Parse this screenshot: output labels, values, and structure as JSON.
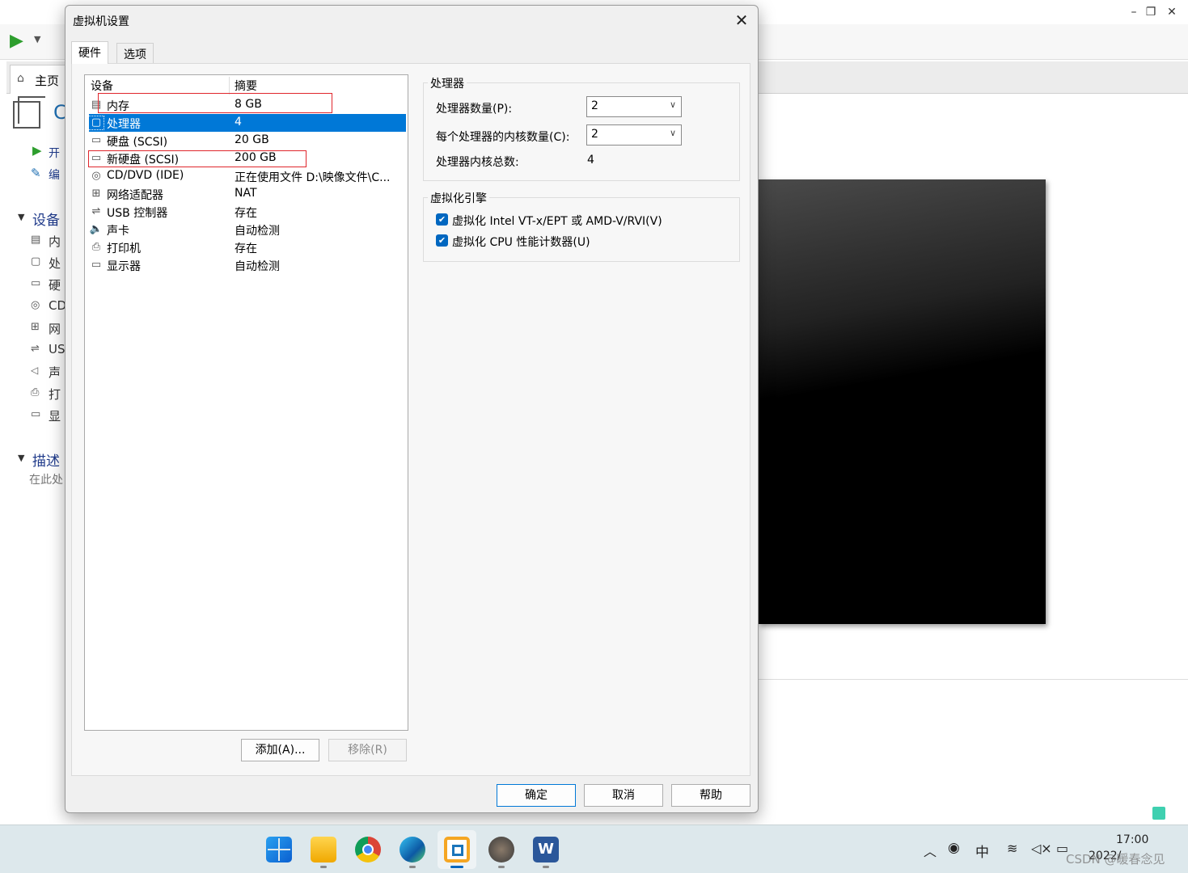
{
  "background_app": {
    "home_tab": "主页",
    "sidebar_actions": [
      "开",
      "编"
    ],
    "devices_section": "设备",
    "sidebar_devices": [
      "内",
      "处",
      "硬",
      "CD",
      "网",
      "US",
      "声",
      "打",
      "显"
    ],
    "description_section": "描述",
    "description_hint": "在此处",
    "window_controls": [
      "–",
      "❐",
      "✕"
    ]
  },
  "dialog": {
    "title": "虚拟机设置",
    "close": "✕",
    "tabs": [
      "硬件",
      "选项"
    ],
    "list_headers": {
      "device": "设备",
      "summary": "摘要"
    },
    "devices": [
      {
        "icon": "memory-icon",
        "glyph": "▤",
        "name": "内存",
        "summary": "8 GB"
      },
      {
        "icon": "processor-icon",
        "glyph": "▢",
        "name": "处理器",
        "summary": "4"
      },
      {
        "icon": "harddisk-icon",
        "glyph": "▭",
        "name": "硬盘 (SCSI)",
        "summary": "20 GB"
      },
      {
        "icon": "harddisk-icon",
        "glyph": "▭",
        "name": "新硬盘 (SCSI)",
        "summary": "200 GB"
      },
      {
        "icon": "cd-dvd-icon",
        "glyph": "◎",
        "name": "CD/DVD (IDE)",
        "summary": "正在使用文件 D:\\映像文件\\C..."
      },
      {
        "icon": "network-adapter-icon",
        "glyph": "⊞",
        "name": "网络适配器",
        "summary": "NAT"
      },
      {
        "icon": "usb-icon",
        "glyph": "⇌",
        "name": "USB 控制器",
        "summary": "存在"
      },
      {
        "icon": "sound-icon",
        "glyph": "🔈",
        "name": "声卡",
        "summary": "自动检测"
      },
      {
        "icon": "printer-icon",
        "glyph": "⎙",
        "name": "打印机",
        "summary": "存在"
      },
      {
        "icon": "display-icon",
        "glyph": "▭",
        "name": "显示器",
        "summary": "自动检测"
      }
    ],
    "add_button": "添加(A)...",
    "remove_button": "移除(R)",
    "processor_group": {
      "title": "处理器",
      "count_label": "处理器数量(P):",
      "count_value": "2",
      "cores_label": "每个处理器的内核数量(C):",
      "cores_value": "2",
      "total_label": "处理器内核总数:",
      "total_value": "4"
    },
    "virtualization_group": {
      "title": "虚拟化引擎",
      "option1": "虚拟化 Intel VT-x/EPT 或 AMD-V/RVI(V)",
      "option2": "虚拟化 CPU 性能计数器(U)"
    },
    "ok_button": "确定",
    "cancel_button": "取消",
    "help_button": "帮助"
  },
  "taskbar": {
    "ime": "中",
    "time": "17:00",
    "date": "2022/",
    "watermark": "CSDN @暖春念见"
  },
  "colors": {
    "selection": "#0078d7",
    "highlight_box": "#e0262c",
    "accent": "#0067c0"
  }
}
